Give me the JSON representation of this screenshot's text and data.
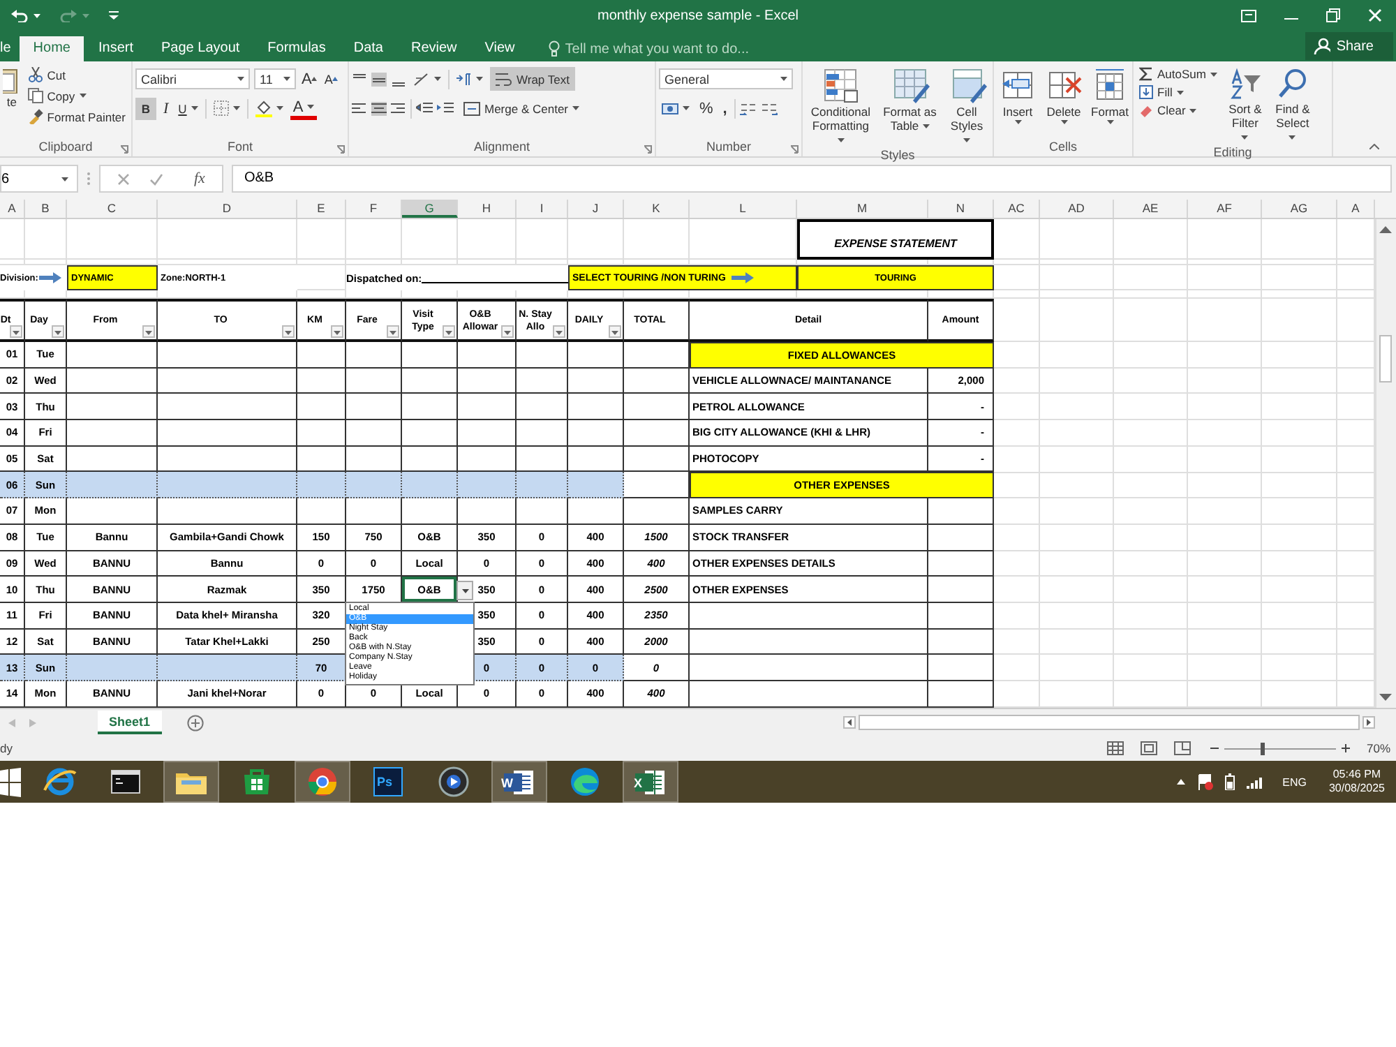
{
  "window": {
    "title": "monthly expense sample - Excel"
  },
  "ribbon_tabs": [
    {
      "label": "le",
      "selected": false
    },
    {
      "label": "Home",
      "selected": true
    },
    {
      "label": "Insert",
      "selected": false
    },
    {
      "label": "Page Layout",
      "selected": false
    },
    {
      "label": "Formulas",
      "selected": false
    },
    {
      "label": "Data",
      "selected": false
    },
    {
      "label": "Review",
      "selected": false
    },
    {
      "label": "View",
      "selected": false
    }
  ],
  "tell_me": {
    "placeholder": "Tell me what you want to do..."
  },
  "share": "Share",
  "clipboard": {
    "label": "Clipboard",
    "paste": "te",
    "cut": "Cut",
    "copy": "Copy",
    "format_painter": "Format Painter"
  },
  "font": {
    "label": "Font",
    "name": "Calibri",
    "size": "11",
    "grow": "A",
    "shrink": "A",
    "bold": {
      "label": "B",
      "on": true
    },
    "italic": "I",
    "underline": "U",
    "font_color": "A"
  },
  "alignment": {
    "label": "Alignment",
    "wrap_text": {
      "label": "Wrap Text",
      "on": true
    },
    "merge": "Merge & Center"
  },
  "number": {
    "label": "Number",
    "format": "General",
    "percent": "%",
    "comma": ","
  },
  "styles": {
    "label": "Styles",
    "buttons": [
      {
        "kind": "conditional",
        "label": "Conditional Formatting"
      },
      {
        "kind": "table",
        "label": "Format as Table"
      },
      {
        "kind": "cell",
        "label": "Cell Styles"
      }
    ]
  },
  "cells": {
    "label": "Cells",
    "buttons": [
      {
        "kind": "insert",
        "label": "Insert"
      },
      {
        "kind": "delete",
        "label": "Delete"
      },
      {
        "kind": "format",
        "label": "Format"
      }
    ]
  },
  "editing": {
    "label": "Editing",
    "autosum": "AutoSum",
    "fill": "Fill",
    "clear": "Clear",
    "sort": "Sort & Filter",
    "find": "Find & Select"
  },
  "formula_bar": {
    "name_box": "6",
    "fx": "fx",
    "value": "O&B"
  },
  "columns": [
    {
      "label": "A",
      "selected": false
    },
    {
      "label": "B",
      "selected": false
    },
    {
      "label": "C",
      "selected": false
    },
    {
      "label": "D",
      "selected": false
    },
    {
      "label": "E",
      "selected": false
    },
    {
      "label": "F",
      "selected": false
    },
    {
      "label": "G",
      "selected": true
    },
    {
      "label": "H",
      "selected": false
    },
    {
      "label": "I",
      "selected": false
    },
    {
      "label": "J",
      "selected": false
    },
    {
      "label": "K",
      "selected": false
    },
    {
      "label": "L",
      "selected": false
    },
    {
      "label": "M",
      "selected": false
    },
    {
      "label": "N",
      "selected": false
    },
    {
      "label": "AC",
      "selected": false
    },
    {
      "label": "AD",
      "selected": false
    },
    {
      "label": "AE",
      "selected": false
    },
    {
      "label": "AF",
      "selected": false
    },
    {
      "label": "AG",
      "selected": false
    },
    {
      "label": "A",
      "selected": false
    }
  ],
  "sheet": {
    "title": "EXPENSE STATEMENT",
    "division_label": "Division:",
    "division": "DYNAMIC",
    "zone": "Zone:NORTH-1",
    "dispatched": "Dispatched on:",
    "touring_prompt": "SELECT TOURING /NON TURING",
    "touring": "TOURING"
  },
  "table": {
    "columns": [
      {
        "label": "Dt",
        "filter": true
      },
      {
        "label": "Day",
        "filter": true
      },
      {
        "label": "From",
        "filter": true
      },
      {
        "label": "TO",
        "filter": true
      },
      {
        "label": "KM",
        "filter": true
      },
      {
        "label": "Fare",
        "filter": true
      },
      {
        "label": "Visit Type",
        "filter": true
      },
      {
        "label": "O&B Allowar",
        "filter": true
      },
      {
        "label": "N. Stay Allo",
        "filter": true
      },
      {
        "label": "DAILY",
        "filter": true
      },
      {
        "label": "TOTAL",
        "filter": false
      }
    ],
    "rows": [
      {
        "dt": "01",
        "day": "Tue",
        "weekend": false
      },
      {
        "dt": "02",
        "day": "Wed",
        "weekend": false
      },
      {
        "dt": "03",
        "day": "Thu",
        "weekend": false
      },
      {
        "dt": "04",
        "day": "Fri",
        "weekend": false
      },
      {
        "dt": "05",
        "day": "Sat",
        "weekend": false
      },
      {
        "dt": "06",
        "day": "Sun",
        "weekend": true
      },
      {
        "dt": "07",
        "day": "Mon",
        "weekend": false
      },
      {
        "dt": "08",
        "day": "Tue",
        "from": "Bannu",
        "to": "Gambila+Gandi Chowk",
        "km": "150",
        "fare": "750",
        "visit": "O&B",
        "ob": "350",
        "nstay": "0",
        "daily": "400",
        "total": "1500",
        "weekend": false
      },
      {
        "dt": "09",
        "day": "Wed",
        "from": "BANNU",
        "to": "Bannu",
        "km": "0",
        "fare": "0",
        "visit": "Local",
        "ob": "0",
        "nstay": "0",
        "daily": "400",
        "total": "400",
        "weekend": false
      },
      {
        "dt": "10",
        "day": "Thu",
        "from": "BANNU",
        "to": "Razmak",
        "km": "350",
        "fare": "1750",
        "visit": "O&B",
        "ob": "350",
        "nstay": "0",
        "daily": "400",
        "total": "2500",
        "weekend": false,
        "dropdown": {
          "items": [
            {
              "label": "Local",
              "selected": false
            },
            {
              "label": "O&B",
              "selected": true
            },
            {
              "label": "Night Stay",
              "selected": false
            },
            {
              "label": "Back",
              "selected": false
            },
            {
              "label": "O&B with N.Stay",
              "selected": false
            },
            {
              "label": "Company N.Stay",
              "selected": false
            },
            {
              "label": "Leave",
              "selected": false
            },
            {
              "label": "Holiday",
              "selected": false
            }
          ]
        }
      },
      {
        "dt": "11",
        "day": "Fri",
        "from": "BANNU",
        "to": "Data khel+ Miransha",
        "km": "320",
        "ob": "350",
        "nstay": "0",
        "daily": "400",
        "total": "2350",
        "weekend": false
      },
      {
        "dt": "12",
        "day": "Sat",
        "from": "BANNU",
        "to": "Tatar Khel+Lakki",
        "km": "250",
        "ob": "350",
        "nstay": "0",
        "daily": "400",
        "total": "2000",
        "weekend": false
      },
      {
        "dt": "13",
        "day": "Sun",
        "km": "70",
        "ob": "0",
        "nstay": "0",
        "daily": "0",
        "total": "0",
        "weekend": true
      },
      {
        "dt": "14",
        "day": "Mon",
        "from": "BANNU",
        "to": "Jani khel+Norar",
        "km": "0",
        "fare": "0",
        "visit": "Local",
        "ob": "0",
        "nstay": "0",
        "daily": "400",
        "total": "400",
        "weekend": false
      }
    ]
  },
  "details": {
    "columns": [
      "Detail",
      "Amount"
    ],
    "rows": [
      {
        "kind": "heading",
        "label": "FIXED ALLOWANCES"
      },
      {
        "kind": "item",
        "label": "VEHICLE ALLOWNACE/ MAINTANANCE",
        "amount": "2,000"
      },
      {
        "kind": "item",
        "label": "PETROL ALLOWANCE",
        "amount": "-"
      },
      {
        "kind": "item",
        "label": "BIG CITY ALLOWANCE (KHI & LHR)",
        "amount": "-"
      },
      {
        "kind": "item",
        "label": "PHOTOCOPY",
        "amount": "-"
      },
      {
        "kind": "heading",
        "label": "OTHER EXPENSES"
      },
      {
        "kind": "item",
        "label": "SAMPLES CARRY"
      },
      {
        "kind": "item",
        "label": "STOCK TRANSFER"
      },
      {
        "kind": "item",
        "label": "OTHER EXPENSES DETAILS"
      },
      {
        "kind": "item",
        "label": "OTHER EXPENSES"
      },
      {
        "kind": "item"
      },
      {
        "kind": "item"
      },
      {
        "kind": "item"
      },
      {
        "kind": "item"
      }
    ]
  },
  "sheet_tabs": [
    {
      "label": "Sheet1",
      "selected": true
    }
  ],
  "status_bar": {
    "text": "dy",
    "zoom": "70%",
    "level": 0.35
  },
  "taskbar": {
    "apps": [
      {
        "kind": "start",
        "running": false
      },
      {
        "kind": "ie",
        "running": false
      },
      {
        "kind": "cmd",
        "running": false
      },
      {
        "kind": "explorer",
        "running": true
      },
      {
        "kind": "store",
        "running": false
      },
      {
        "kind": "chrome",
        "running": true
      },
      {
        "kind": "photoshop",
        "label": "Ps",
        "running": false
      },
      {
        "kind": "media",
        "running": false
      },
      {
        "kind": "word",
        "label": "W",
        "running": true
      },
      {
        "kind": "edge",
        "running": false
      },
      {
        "kind": "excel",
        "label": "X",
        "running": true
      }
    ],
    "language": "ENG",
    "time": "05:46 PM",
    "date": "30/08/2025"
  }
}
